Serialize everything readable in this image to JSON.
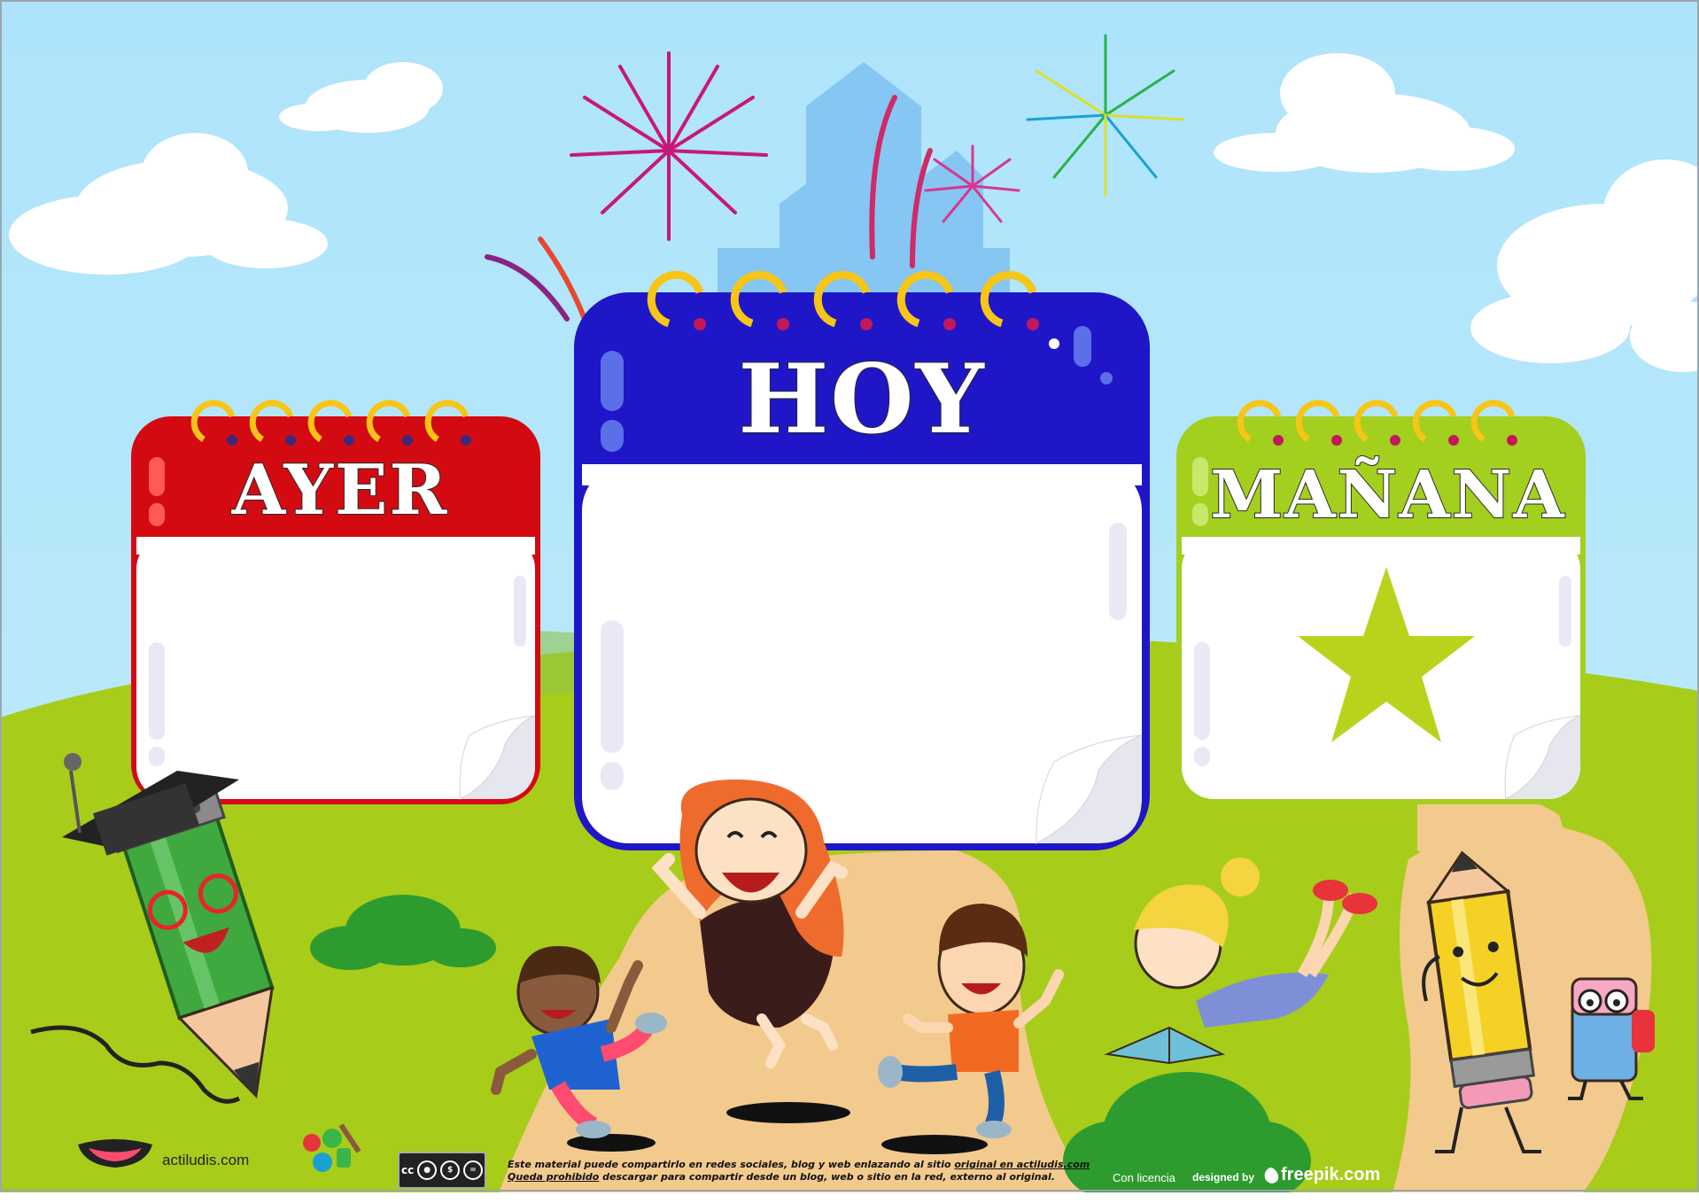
{
  "calendars": {
    "yesterday": {
      "title": "AYER",
      "header_color": "#d40a12"
    },
    "today": {
      "title": "HOY",
      "header_color": "#1f16c7"
    },
    "tomorrow": {
      "title": "MAÑANA",
      "header_color": "#a3cf1f"
    }
  },
  "star_color": "#b9d31c",
  "footer": {
    "site": "actiludis.com",
    "legal_line1_a": "Este material puede compartirlo en redes sociales, blog y web enlazando al sitio ",
    "legal_line1_b": "original en actiludis.com",
    "legal_line2_a": "Queda prohibido",
    "legal_line2_b": " descargar para compartir desde un blog, web o sitio en la red, externo al original.",
    "license_label": "Con licencia",
    "designed_label": "designed by",
    "freepik_label": "freepik.com",
    "cc_label": "cc"
  }
}
